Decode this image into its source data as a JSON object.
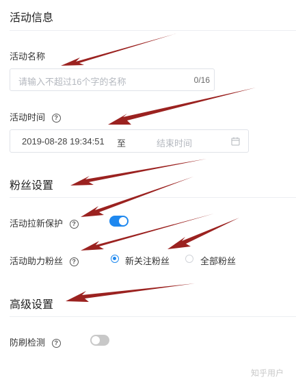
{
  "sections": {
    "activity_info": "活动信息",
    "fans_settings": "粉丝设置",
    "advanced_settings": "高级设置"
  },
  "fields": {
    "name": {
      "label": "活动名称",
      "placeholder": "请输入不超过16个字的名称",
      "counter": "0/16"
    },
    "time": {
      "label": "活动时间",
      "start_value": "2019-08-28 19:34:51",
      "separator": "至",
      "end_placeholder": "结束时间"
    },
    "new_user_protection": {
      "label": "活动拉新保护",
      "enabled": true
    },
    "assist_fans": {
      "label": "活动助力粉丝",
      "options": [
        "新关注粉丝",
        "全部粉丝"
      ],
      "selected": "新关注粉丝"
    },
    "anti_fraud": {
      "label": "防刷检测",
      "enabled": false
    }
  },
  "icons": {
    "help": "?",
    "calendar": "calendar-icon"
  },
  "colors": {
    "accent": "#1e88ef",
    "arrow": "#9b2220",
    "toggle_off": "#c8c8c8"
  },
  "watermark": "知乎用户"
}
